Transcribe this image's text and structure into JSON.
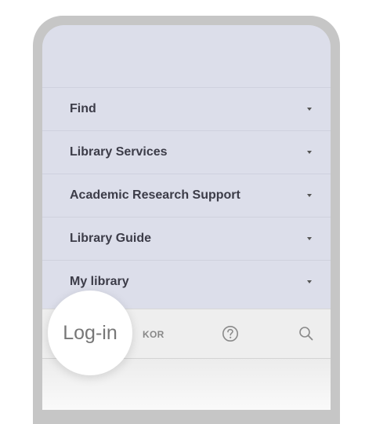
{
  "menu": {
    "items": [
      {
        "label": "Find"
      },
      {
        "label": "Library Services"
      },
      {
        "label": "Academic Research Support"
      },
      {
        "label": "Library Guide"
      },
      {
        "label": "My library"
      }
    ]
  },
  "bottom_bar": {
    "login_label": "Log-in",
    "language_label": "KOR",
    "help_icon": "question-circle-icon",
    "search_icon": "search-icon"
  },
  "colors": {
    "menu_background": "#dcdeea",
    "menu_text": "#3c3c48",
    "phone_frame": "#c6c6c6",
    "bottom_bar_background": "#eeeeee"
  }
}
